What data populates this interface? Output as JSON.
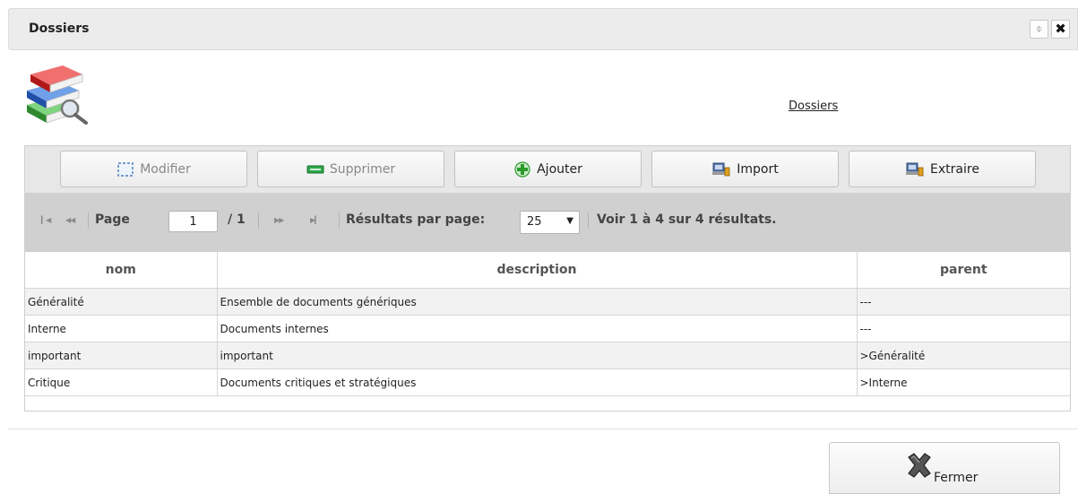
{
  "window": {
    "title": "Dossiers",
    "refresh_glyph": "⌽",
    "close_glyph": "✖"
  },
  "header": {
    "link": "Dossiers"
  },
  "toolbar": {
    "modifier": "Modifier",
    "supprimer": "Supprimer",
    "ajouter": "Ajouter",
    "import": "Import",
    "extraire": "Extraire"
  },
  "pager": {
    "page_label": "Page",
    "current_page": "1",
    "total_pages": "/ 1",
    "per_page_label": "Résultats par page:",
    "per_page_value": "25",
    "summary": "Voir 1 à 4 sur 4 résultats."
  },
  "table": {
    "headers": {
      "nom": "nom",
      "description": "description",
      "parent": "parent"
    },
    "rows": [
      {
        "nom": "Généralité",
        "description": "Ensemble de documents génériques",
        "parent": "---"
      },
      {
        "nom": "Interne",
        "description": "Documents internes",
        "parent": "---"
      },
      {
        "nom": "important",
        "description": "important",
        "parent": ">Généralité"
      },
      {
        "nom": "Critique",
        "description": "Documents critiques et stratégiques",
        "parent": ">Interne"
      }
    ]
  },
  "footer": {
    "fermer": "Fermer"
  },
  "icons": {
    "books": "books-icon",
    "modifier": "edit-frame-icon",
    "supprimer": "minus-icon",
    "ajouter": "plus-icon",
    "import": "import-icon",
    "extraire": "extract-icon",
    "fermer": "close-x-icon"
  },
  "colors": {
    "titlebar": "#ececec",
    "toolbar": "#e7e7e7",
    "pager": "#d0d0d0",
    "row_alt": "#f2f2f2",
    "add_green": "#2e9a2e"
  }
}
